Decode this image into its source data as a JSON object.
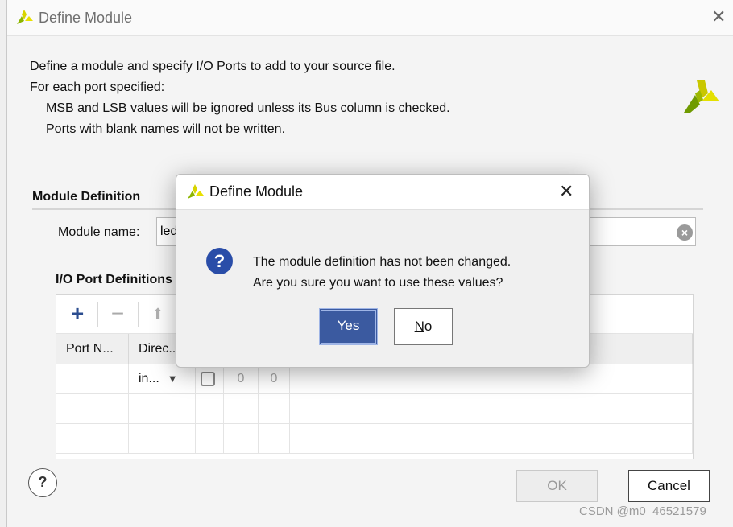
{
  "window": {
    "title": "Define Module",
    "intro_line1": "Define a module and specify I/O Ports to add to your source file.",
    "intro_line2": "For each port specified:",
    "intro_line3": "MSB and LSB values will be ignored unless its Bus column is checked.",
    "intro_line4": "Ports with blank names will not be written."
  },
  "module_definition": {
    "section_title": "Module Definition",
    "name_label_accesskey": "M",
    "name_label_rest": "odule name:",
    "name_value": "led"
  },
  "io_ports": {
    "title": "I/O Port Definitions",
    "toolbar": {
      "add": "+",
      "remove": "−",
      "move_up": "⬆"
    },
    "columns": [
      "Port N...",
      "Direc..."
    ],
    "rows": [
      {
        "name": "",
        "direction": "in...",
        "bus": false,
        "msb": "0",
        "lsb": "0"
      }
    ]
  },
  "footer": {
    "help": "?",
    "ok": "OK",
    "cancel": "Cancel"
  },
  "dialog": {
    "title": "Define Module",
    "message_line1": "The module definition has not been changed.",
    "message_line2": "Are you sure you want to use these values?",
    "yes_accesskey": "Y",
    "yes_rest": "es",
    "no_accesskey": "N",
    "no_rest": "o"
  },
  "watermark": "CSDN @m0_46521579",
  "colors": {
    "accent": "#3b5aa0",
    "logo_green": "#8db600",
    "logo_yellow": "#d8d400",
    "question_icon": "#2a4da8"
  }
}
